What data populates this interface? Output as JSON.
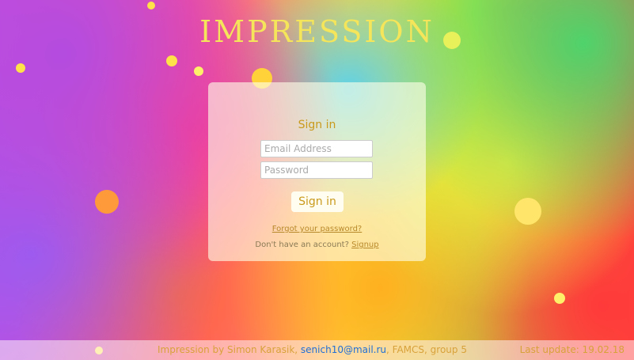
{
  "app": {
    "title": "IMPRESSION"
  },
  "signin": {
    "heading": "Sign in",
    "email_placeholder": "Email Address",
    "password_placeholder": "Password",
    "button_label": "Sign in",
    "forgot_link": "Forgot your password?",
    "no_account_text": "Don't have an account?",
    "signup_link": "Signup"
  },
  "footer": {
    "credit_prefix": "Impression by Simon Karasik,",
    "email": "senich10@mail.ru",
    "credit_suffix": ", FAMCS, group 5",
    "last_update": "Last update: 19.02.18"
  },
  "colors": {
    "logo": "#f4e55a",
    "accent": "#c99a1c",
    "link": "#1e6fd6"
  }
}
